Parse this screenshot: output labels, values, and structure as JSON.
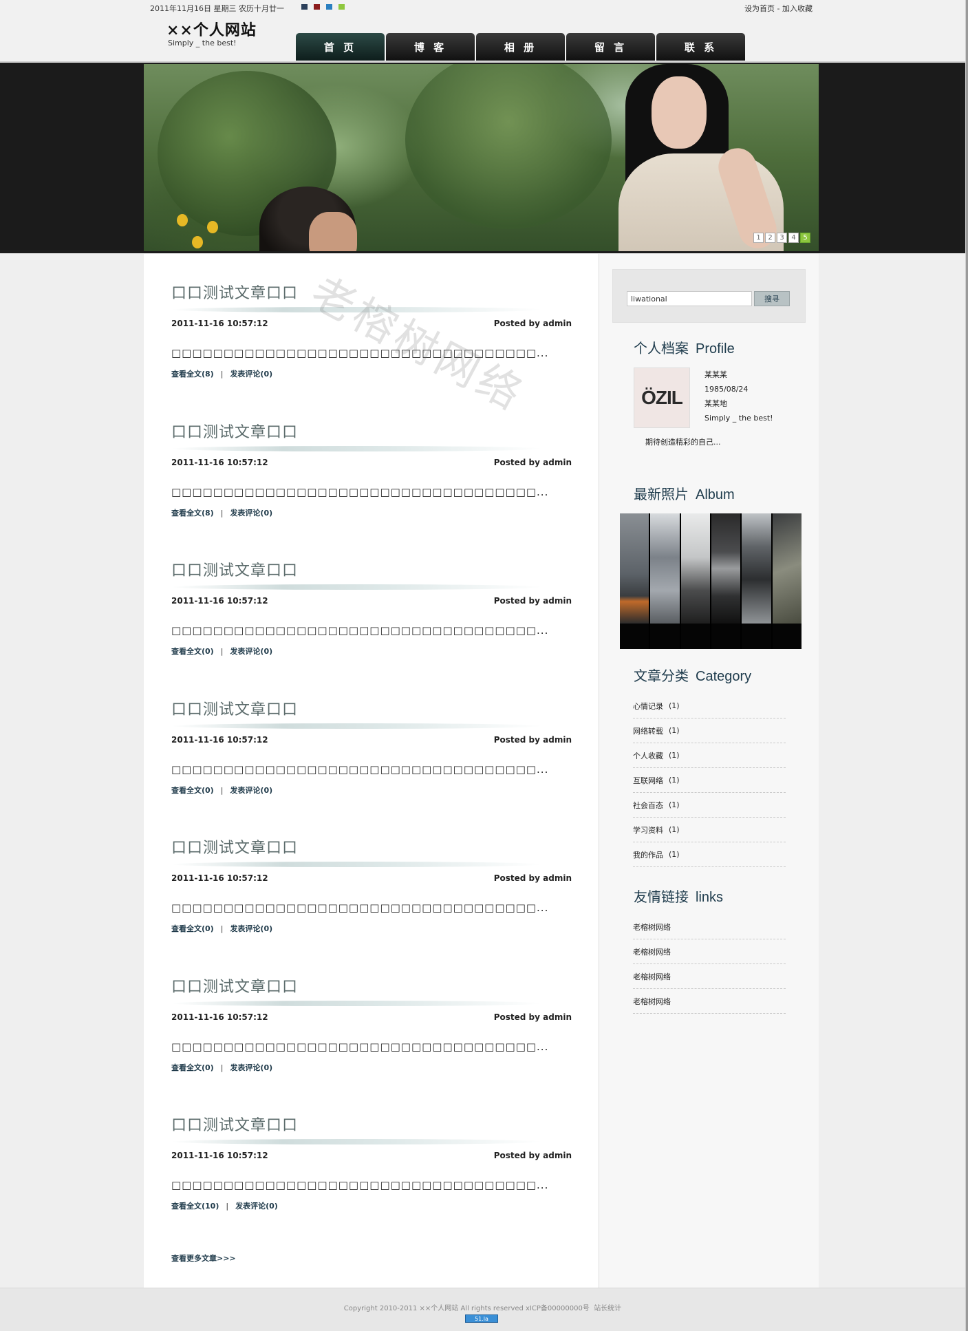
{
  "header": {
    "date_line": "2011年11月16日 星期三 农历十月廿一",
    "swatch_colors": [
      "#2b3f5a",
      "#8b1b1b",
      "#2a7fc0",
      "#8fc73e"
    ],
    "set_home": "设为首页",
    "separator": " - ",
    "add_favorite": "加入收藏",
    "logo": "××个人网站",
    "slogan": "Simply _ the best!"
  },
  "nav": [
    {
      "label": "首 页"
    },
    {
      "label": "博 客"
    },
    {
      "label": "相 册"
    },
    {
      "label": "留 言"
    },
    {
      "label": "联 系"
    }
  ],
  "banner": {
    "pages": [
      "1",
      "2",
      "3",
      "4",
      "5"
    ],
    "active_page": 5
  },
  "watermark": "老榕树网络",
  "posts": [
    {
      "title": "口口测试文章口口",
      "date": "2011-11-16 10:57:12",
      "author": "Posted by admin",
      "body": "□□□□□□□□□□□□□□□□□□□□□□□□□□□□□□□□□□□...",
      "read_more": "查看全文(8)",
      "comment": "发表评论(0)"
    },
    {
      "title": "口口测试文章口口",
      "date": "2011-11-16 10:57:12",
      "author": "Posted by admin",
      "body": "□□□□□□□□□□□□□□□□□□□□□□□□□□□□□□□□□□□...",
      "read_more": "查看全文(8)",
      "comment": "发表评论(0)"
    },
    {
      "title": "口口测试文章口口",
      "date": "2011-11-16 10:57:12",
      "author": "Posted by admin",
      "body": "□□□□□□□□□□□□□□□□□□□□□□□□□□□□□□□□□□□...",
      "read_more": "查看全文(0)",
      "comment": "发表评论(0)"
    },
    {
      "title": "口口测试文章口口",
      "date": "2011-11-16 10:57:12",
      "author": "Posted by admin",
      "body": "□□□□□□□□□□□□□□□□□□□□□□□□□□□□□□□□□□□...",
      "read_more": "查看全文(0)",
      "comment": "发表评论(0)"
    },
    {
      "title": "口口测试文章口口",
      "date": "2011-11-16 10:57:12",
      "author": "Posted by admin",
      "body": "□□□□□□□□□□□□□□□□□□□□□□□□□□□□□□□□□□□...",
      "read_more": "查看全文(0)",
      "comment": "发表评论(0)"
    },
    {
      "title": "口口测试文章口口",
      "date": "2011-11-16 10:57:12",
      "author": "Posted by admin",
      "body": "□□□□□□□□□□□□□□□□□□□□□□□□□□□□□□□□□□□...",
      "read_more": "查看全文(0)",
      "comment": "发表评论(0)"
    },
    {
      "title": "口口测试文章口口",
      "date": "2011-11-16 10:57:12",
      "author": "Posted by admin",
      "body": "□□□□□□□□□□□□□□□□□□□□□□□□□□□□□□□□□□□...",
      "read_more": "查看全文(10)",
      "comment": "发表评论(0)"
    }
  ],
  "more_articles": "查看更多文章>>>",
  "sidebar": {
    "search": {
      "value": "liwational",
      "button": "搜寻"
    },
    "profile": {
      "title_cn": "个人档案",
      "title_en": "Profile",
      "avatar_text": "ÖZIL",
      "name": "某某某",
      "birthday": "1985/08/24",
      "location": "某某地",
      "slogan": "Simply _ the best!",
      "motto": "期待创造精彩的自己..."
    },
    "album": {
      "title_cn": "最新照片",
      "title_en": "Album"
    },
    "category": {
      "title_cn": "文章分类",
      "title_en": "Category",
      "items": [
        {
          "name": "心情记录",
          "count": "(1)"
        },
        {
          "name": "网络转载",
          "count": "(1)"
        },
        {
          "name": "个人收藏",
          "count": "(1)"
        },
        {
          "name": "互联网络",
          "count": "(1)"
        },
        {
          "name": "社会百态",
          "count": "(1)"
        },
        {
          "name": "学习资料",
          "count": "(1)"
        },
        {
          "name": "我的作品",
          "count": "(1)"
        }
      ]
    },
    "links": {
      "title_cn": "友情链接",
      "title_en": "links",
      "items": [
        "老榕树网络",
        "老榕树网络",
        "老榕树网络",
        "老榕树网络"
      ]
    }
  },
  "footer": {
    "copyright": "Copyright 2010-2011 ××个人网站  All rights reserved  ",
    "icp": "xICP备00000000号",
    "stats": "站长统计",
    "badge": "51.la"
  }
}
